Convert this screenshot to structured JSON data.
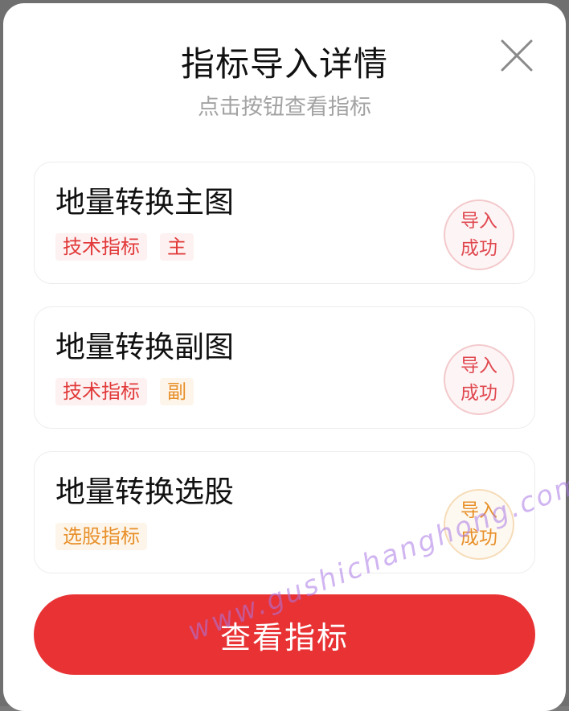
{
  "dialog": {
    "title": "指标导入详情",
    "subtitle": "点击按钮查看指标",
    "close_icon": "close-icon"
  },
  "cards": [
    {
      "title": "地量转换主图",
      "tags": [
        "技术指标",
        "主"
      ],
      "badge": {
        "line1": "导入",
        "line2": "成功"
      }
    },
    {
      "title": "地量转换副图",
      "tags": [
        "技术指标",
        "副"
      ],
      "badge": {
        "line1": "导入",
        "line2": "成功"
      }
    },
    {
      "title": "地量转换选股",
      "tags": [
        "选股指标"
      ],
      "badge": {
        "line1": "导入",
        "line2": "成功"
      }
    }
  ],
  "actions": {
    "view_label": "查看指标"
  },
  "watermark": "www.gushichanghong.com",
  "colors": {
    "accent_red": "#e83234",
    "tag_red": "#e23a3a",
    "tag_orange": "#e8902a",
    "title": "#111111",
    "subtitle": "#a3a3a3"
  }
}
